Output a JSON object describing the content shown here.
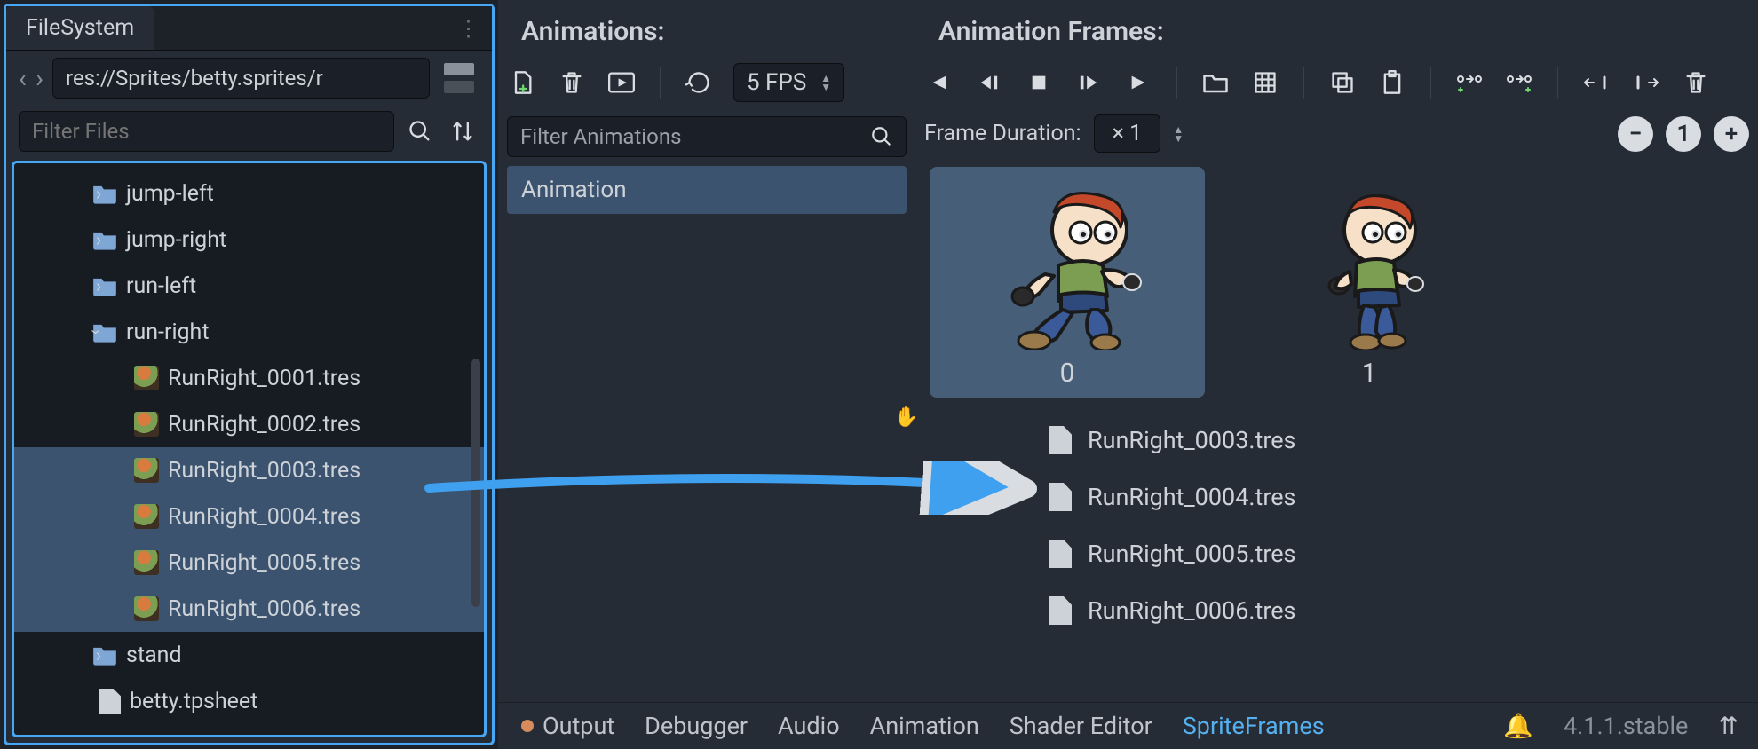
{
  "fs": {
    "tab": "FileSystem",
    "path": "res://Sprites/betty.sprites/r",
    "filter_placeholder": "Filter Files",
    "folders": [
      {
        "name": "jump-left",
        "expanded": false
      },
      {
        "name": "jump-right",
        "expanded": false
      },
      {
        "name": "run-left",
        "expanded": false
      },
      {
        "name": "run-right",
        "expanded": true
      },
      {
        "name": "stand",
        "expanded": false
      }
    ],
    "run_right_files": [
      "RunRight_0001.tres",
      "RunRight_0002.tres",
      "RunRight_0003.tres",
      "RunRight_0004.tres",
      "RunRight_0005.tres",
      "RunRight_0006.tres"
    ],
    "extra_file": "betty.tpsheet"
  },
  "anim": {
    "header": "Animations:",
    "filter_placeholder": "Filter Animations",
    "fps": "5 FPS",
    "list": [
      "Animation"
    ]
  },
  "frames": {
    "header": "Animation Frames:",
    "duration_label": "Frame Duration:",
    "multiplier": "× 1",
    "zoom_reset": "1",
    "cards": [
      {
        "index": "0"
      },
      {
        "index": "1"
      }
    ],
    "drag_items": [
      "RunRight_0003.tres",
      "RunRight_0004.tres",
      "RunRight_0005.tres",
      "RunRight_0006.tres"
    ]
  },
  "bottom": {
    "tabs": [
      "Output",
      "Debugger",
      "Audio",
      "Animation",
      "Shader Editor",
      "SpriteFrames"
    ],
    "version": "4.1.1.stable"
  }
}
